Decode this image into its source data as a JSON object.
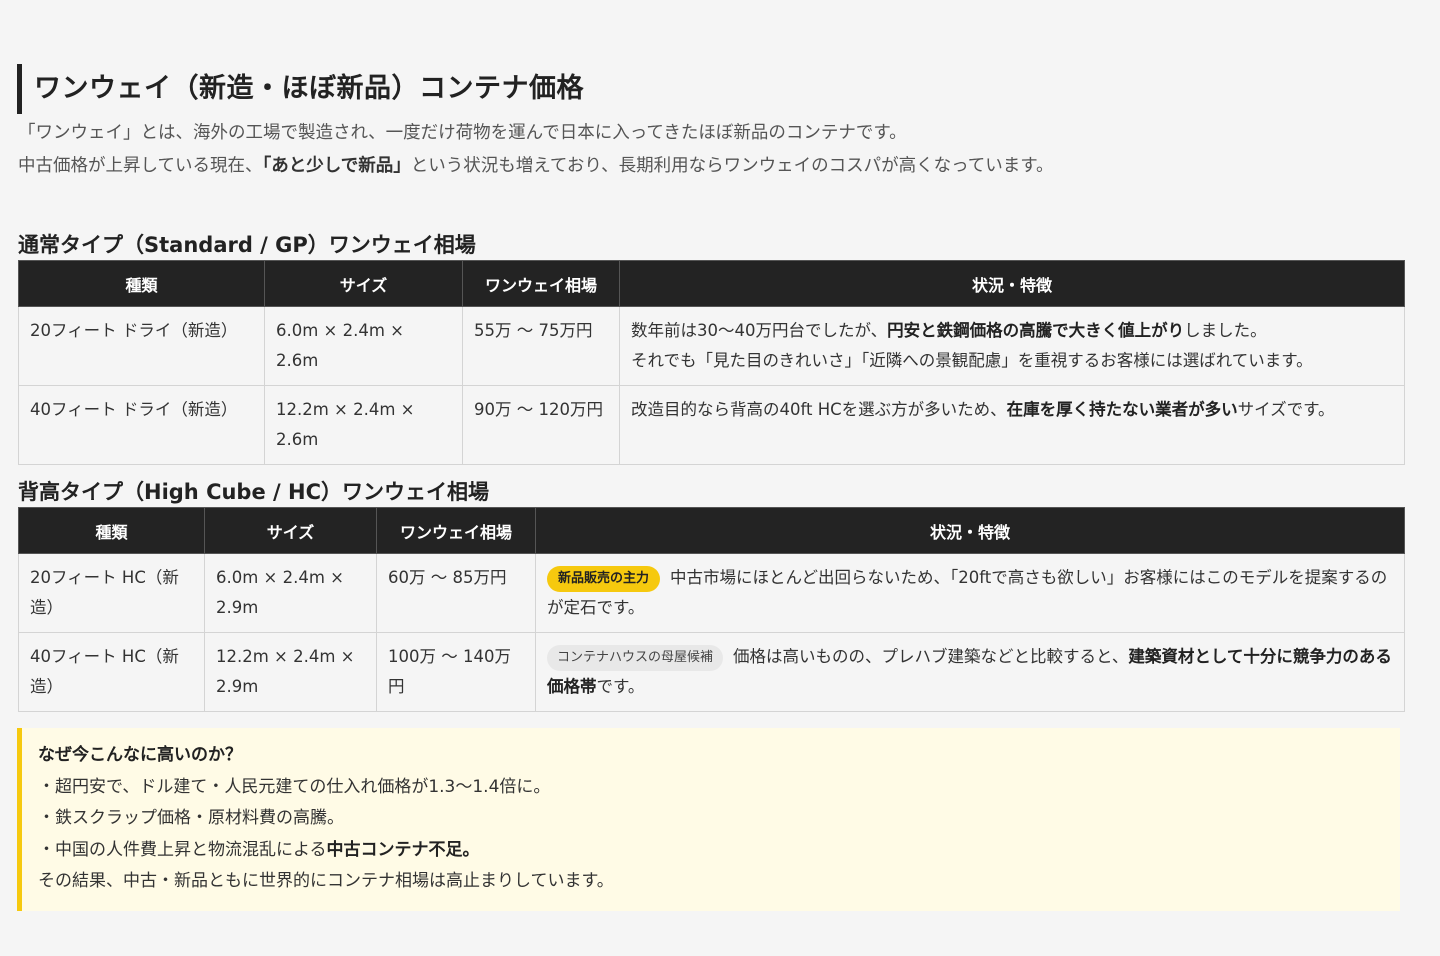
{
  "heading": "ワンウェイ（新造・ほぼ新品）コンテナ価格",
  "intro": {
    "line1": "「ワンウェイ」とは、海外の工場で製造され、一度だけ荷物を運んで日本に入ってきたほぼ新品のコンテナです。",
    "line2_pre": "中古価格が上昇している現在、",
    "line2_bold": "「あと少しで新品」",
    "line2_post": "という状況も増えており、長期利用ならワンウェイのコスパが高くなっています。"
  },
  "standard": {
    "title": "通常タイプ（Standard / GP）ワンウェイ相場",
    "headers": [
      "種類",
      "サイズ",
      "ワンウェイ相場",
      "状況・特徴"
    ],
    "rows": [
      {
        "type": "20フィート ドライ（新造）",
        "size": "6.0m × 2.4m × 2.6m",
        "price": "55万 ～ 75万円",
        "desc_pre": "数年前は30～40万円台でしたが、",
        "desc_bold": "円安と鉄鋼価格の高騰で大きく値上がり",
        "desc_post": "しました。",
        "desc_line2": "それでも「見た目のきれいさ」「近隣への景観配慮」を重視するお客様には選ばれています。"
      },
      {
        "type": "40フィート ドライ（新造）",
        "size": "12.2m × 2.4m × 2.6m",
        "price": "90万 ～ 120万円",
        "desc_pre": "改造目的なら背高の40ft HCを選ぶ方が多いため、",
        "desc_bold": "在庫を厚く持たない業者が多い",
        "desc_post": "サイズです。"
      }
    ]
  },
  "highcube": {
    "title": "背高タイプ（High Cube / HC）ワンウェイ相場",
    "headers": [
      "種類",
      "サイズ",
      "ワンウェイ相場",
      "状況・特徴"
    ],
    "rows": [
      {
        "type": "20フィート HC（新造）",
        "size": "6.0m × 2.4m × 2.9m",
        "price": "60万 ～ 85万円",
        "badge": "新品販売の主力",
        "desc": "中古市場にほとんど出回らないため、「20ftで高さも欲しい」お客様にはこのモデルを提案するのが定石です。"
      },
      {
        "type": "40フィート HC（新造）",
        "size": "12.2m × 2.4m × 2.9m",
        "price": "100万 ～ 140万円",
        "badge": "コンテナハウスの母屋候補",
        "desc_pre": "価格は高いものの、プレハブ建築などと比較すると、",
        "desc_bold": "建築資材として十分に競争力のある価格帯",
        "desc_post": "です。"
      }
    ]
  },
  "note": {
    "title": "なぜ今こんなに高いのか？",
    "item1": "・超円安で、ドル建て・人民元建ての仕入れ価格が1.3～1.4倍に。",
    "item2": "・鉄スクラップ価格・原材料費の高騰。",
    "item3_pre": "・中国の人件費上昇と物流混乱による",
    "item3_bold": "中古コンテナ不足。",
    "conclusion": "その結果、中古・新品ともに世界的にコンテナ相場は高止まりしています。"
  },
  "colors": {
    "header_bg": "#232323",
    "accent_yellow": "#f6c90e",
    "note_bg": "#fffbe6",
    "page_bg": "#f5f5f5"
  }
}
